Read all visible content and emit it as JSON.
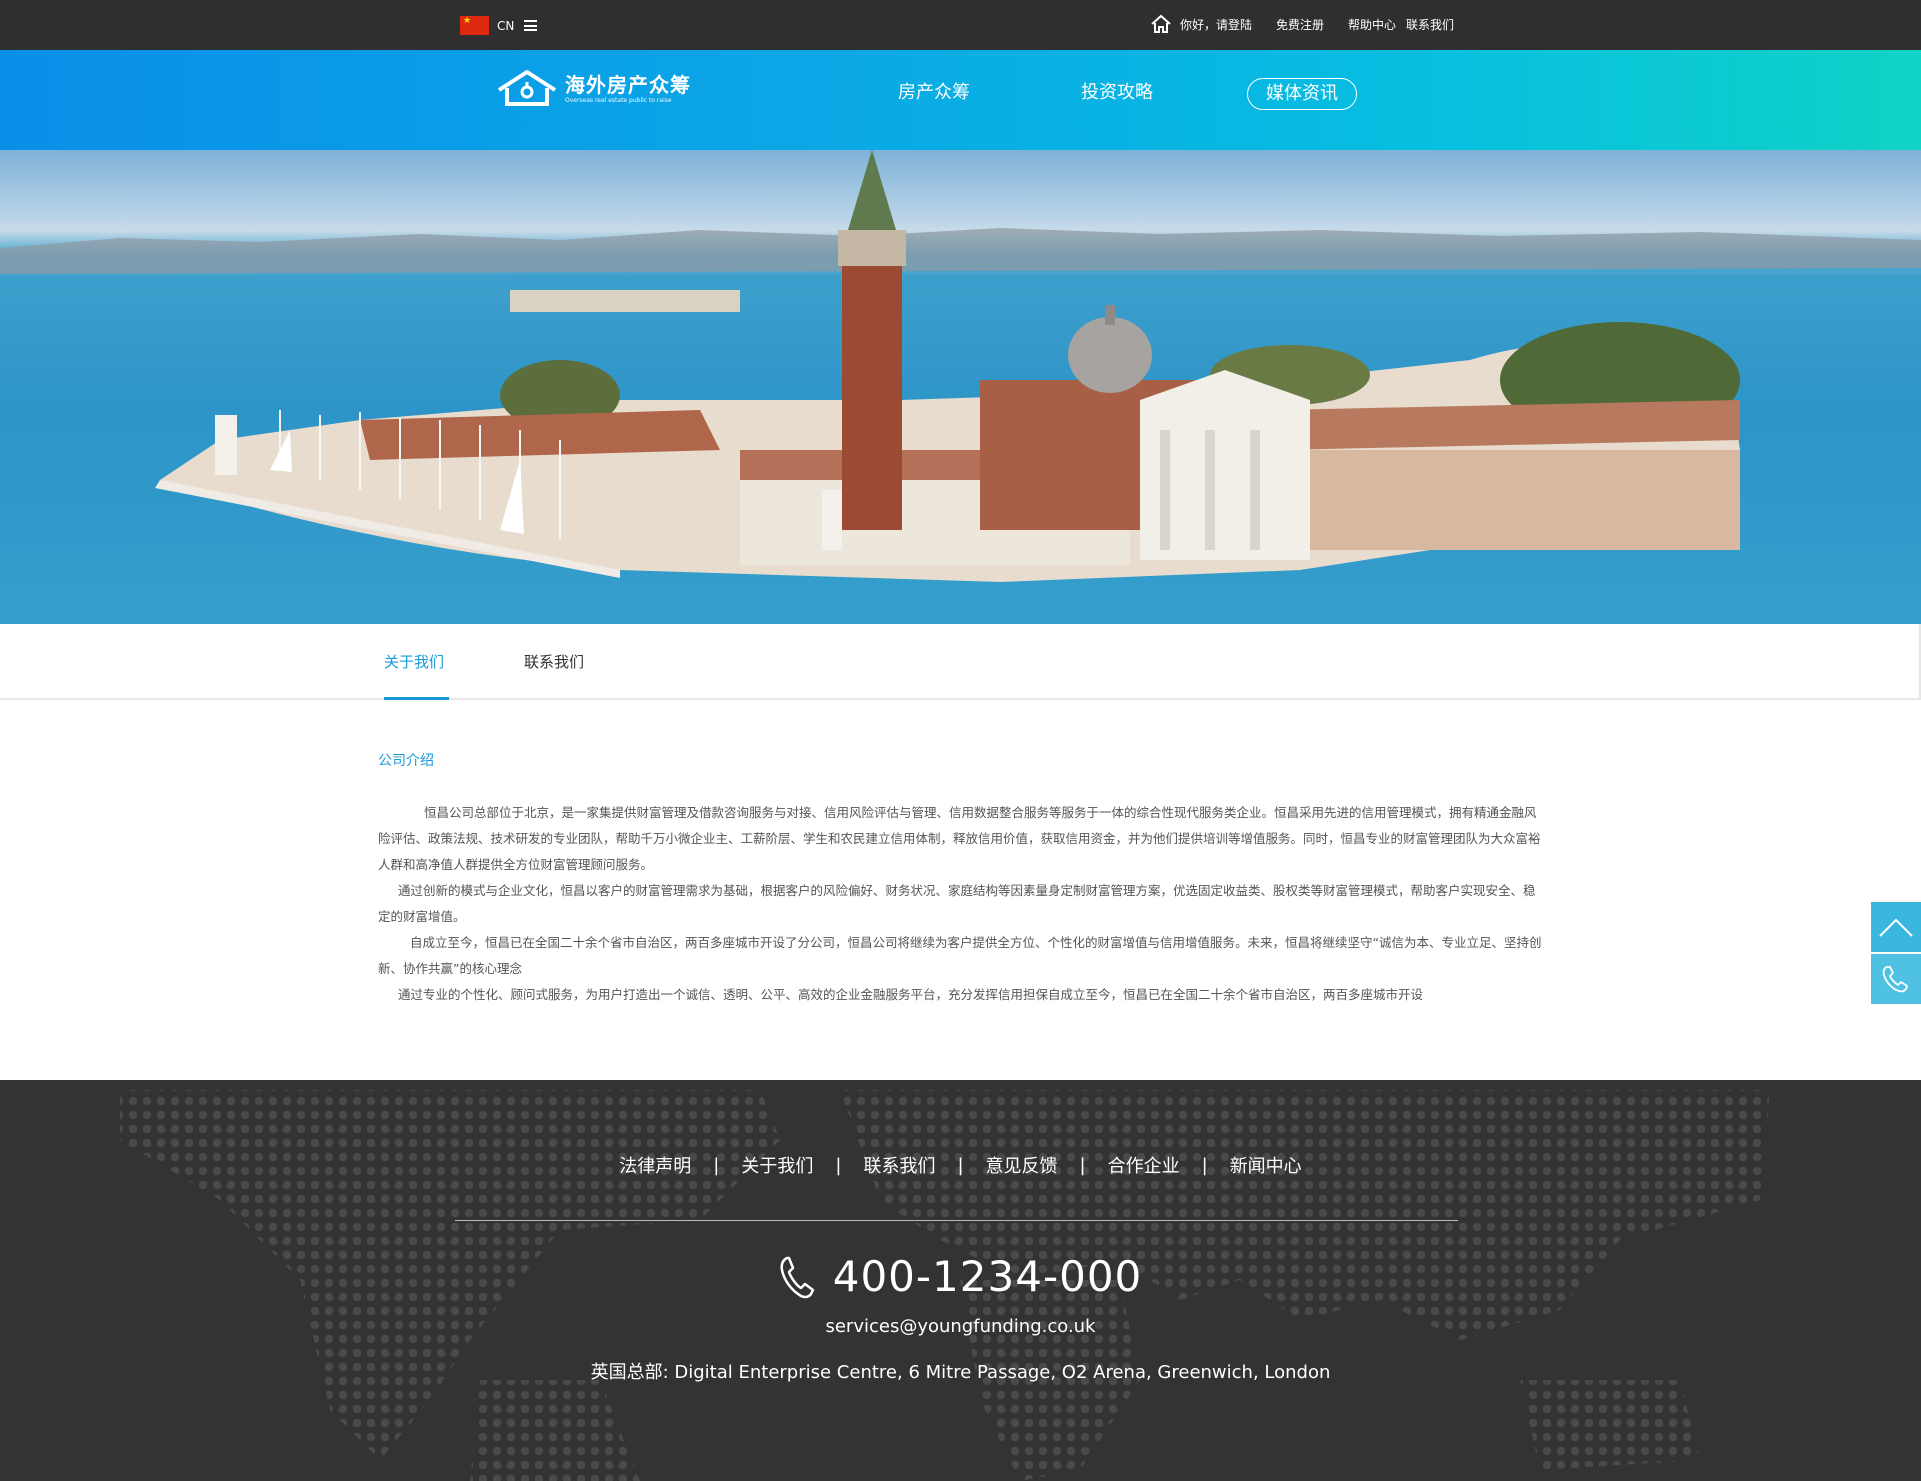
{
  "topbar": {
    "lang_code": "CN",
    "greeting": "你好，请登陆",
    "register": "免费注册",
    "help": "帮助中心",
    "contact": "联系我们"
  },
  "header": {
    "logo_cn": "海外房产众筹",
    "logo_en": "Overseas real estate public to raise",
    "nav": [
      "房产众筹",
      "投资攻略",
      "媒体资讯"
    ],
    "active_nav": "媒体资讯"
  },
  "tabs": {
    "items": [
      "关于我们",
      "联系我们"
    ],
    "active": "关于我们"
  },
  "content": {
    "section_title": "公司介绍",
    "paragraphs": [
      "恒昌公司总部位于北京，是一家集提供财富管理及借款咨询服务与对接、信用风险评估与管理、信用数据整合服务等服务于一体的综合性现代服务类企业。恒昌采用先进的信用管理模式，拥有精通金融风险评估、政策法规、技术研发的专业团队，帮助千万小微企业主、工薪阶层、学生和农民建立信用体制，释放信用价值，获取信用资金，并为他们提供培训等增值服务。同时，恒昌专业的财富管理团队为大众富裕人群和高净值人群提供全方位财富管理顾问服务。",
      "通过创新的模式与企业文化，恒昌以客户的财富管理需求为基础，根据客户的风险偏好、财务状况、家庭结构等因素量身定制财富管理方案，优选固定收益类、股权类等财富管理模式，帮助客户实现安全、稳定的财富增值。",
      "自成立至今，恒昌已在全国二十余个省市自治区，两百多座城市开设了分公司，恒昌公司将继续为客户提供全方位、个性化的财富增值与信用增值服务。未来，恒昌将继续坚守“诚信为本、专业立足、坚持创新、协作共赢”的核心理念",
      "通过专业的个性化、顾问式服务，为用户打造出一个诚信、透明、公平、高效的企业金融服务平台，充分发挥信用担保自成立至今，恒昌已在全国二十余个省市自治区，两百多座城市开设"
    ]
  },
  "footer": {
    "links": [
      "法律声明",
      "关于我们",
      "联系我们",
      "意见反馈",
      "合作企业",
      "新闻中心"
    ],
    "separator": "|",
    "phone": "400-1234-000",
    "email": "services@youngfunding.co.uk",
    "address": "英国总部: Digital Enterprise Centre, 6 Mitre Passage, O2 Arena, Greenwich, London"
  },
  "side_buttons": [
    "back-to-top",
    "phone"
  ],
  "colors": {
    "accent": "#1a9ad9",
    "topbar_bg": "#2f2f2f",
    "footer_bg": "#333333",
    "header_gradient_start": "#0a8fe8",
    "header_gradient_end": "#10d3c6",
    "side_button": "#3ab7dd"
  }
}
